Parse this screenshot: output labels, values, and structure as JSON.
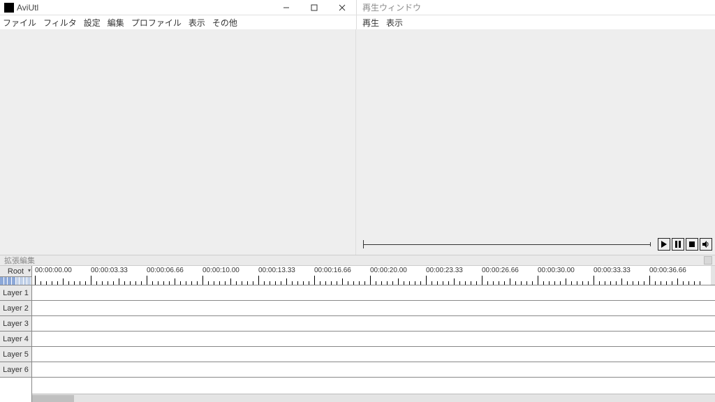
{
  "main_window": {
    "title": "AviUtl",
    "menu": [
      "ファイル",
      "フィルタ",
      "設定",
      "編集",
      "プロファイル",
      "表示",
      "その他"
    ]
  },
  "playback_window": {
    "title": "再生ウィンドウ",
    "menu": [
      "再生",
      "表示"
    ]
  },
  "ext_edit": {
    "title": "拡張編集",
    "root_label": "Root"
  },
  "timeline": {
    "time_labels": [
      "00:00:00.00",
      "00:00:03.33",
      "00:00:06.66",
      "00:00:10.00",
      "00:00:13.33",
      "00:00:16.66",
      "00:00:20.00",
      "00:00:23.33",
      "00:00:26.66",
      "00:00:30.00",
      "00:00:33.33",
      "00:00:36.66"
    ],
    "layers": [
      "Layer 1",
      "Layer 2",
      "Layer 3",
      "Layer 4",
      "Layer 5",
      "Layer 6"
    ]
  },
  "icons": {
    "play": "play",
    "pause": "pause",
    "stop": "stop",
    "vol": "volume"
  }
}
